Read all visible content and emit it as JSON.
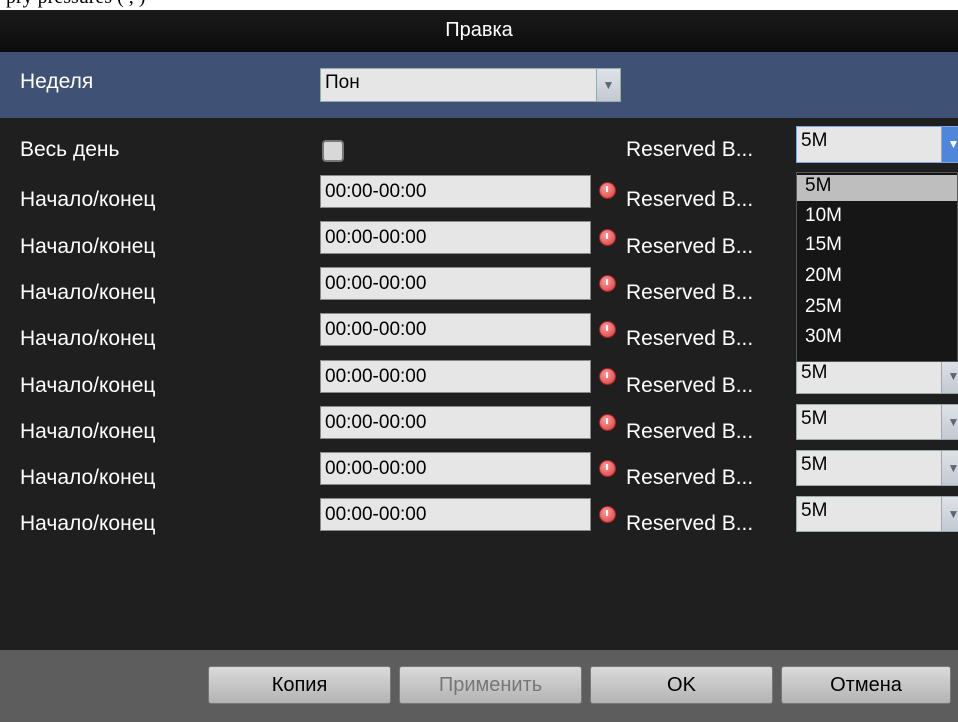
{
  "top_text": "pry pressures ( , )",
  "dialog": {
    "title": "Правка",
    "week": {
      "label": "Неделя",
      "value": "Пон"
    },
    "all_day": {
      "label": "Весь день",
      "checked": false
    },
    "reserved_label": "Reserved B...",
    "reserved_selected": "5M",
    "rows": [
      {
        "label": "Начало/конец",
        "time": "00:00-00:00",
        "reserved": ""
      },
      {
        "label": "Начало/конец",
        "time": "00:00-00:00",
        "reserved": ""
      },
      {
        "label": "Начало/конец",
        "time": "00:00-00:00",
        "reserved": ""
      },
      {
        "label": "Начало/конец",
        "time": "00:00-00:00",
        "reserved": ""
      },
      {
        "label": "Начало/конец",
        "time": "00:00-00:00",
        "reserved": "5M"
      },
      {
        "label": "Начало/конец",
        "time": "00:00-00:00",
        "reserved": "5M"
      },
      {
        "label": "Начало/конец",
        "time": "00:00-00:00",
        "reserved": "5M"
      },
      {
        "label": "Начало/конец",
        "time": "00:00-00:00",
        "reserved": "5M"
      }
    ],
    "dropdown_options": [
      "5M",
      "10M",
      "15M",
      "20M",
      "25M",
      "30M"
    ],
    "buttons": {
      "copy": "Копия",
      "apply": "Применить",
      "ok": "OK",
      "cancel": "Отмена"
    }
  }
}
